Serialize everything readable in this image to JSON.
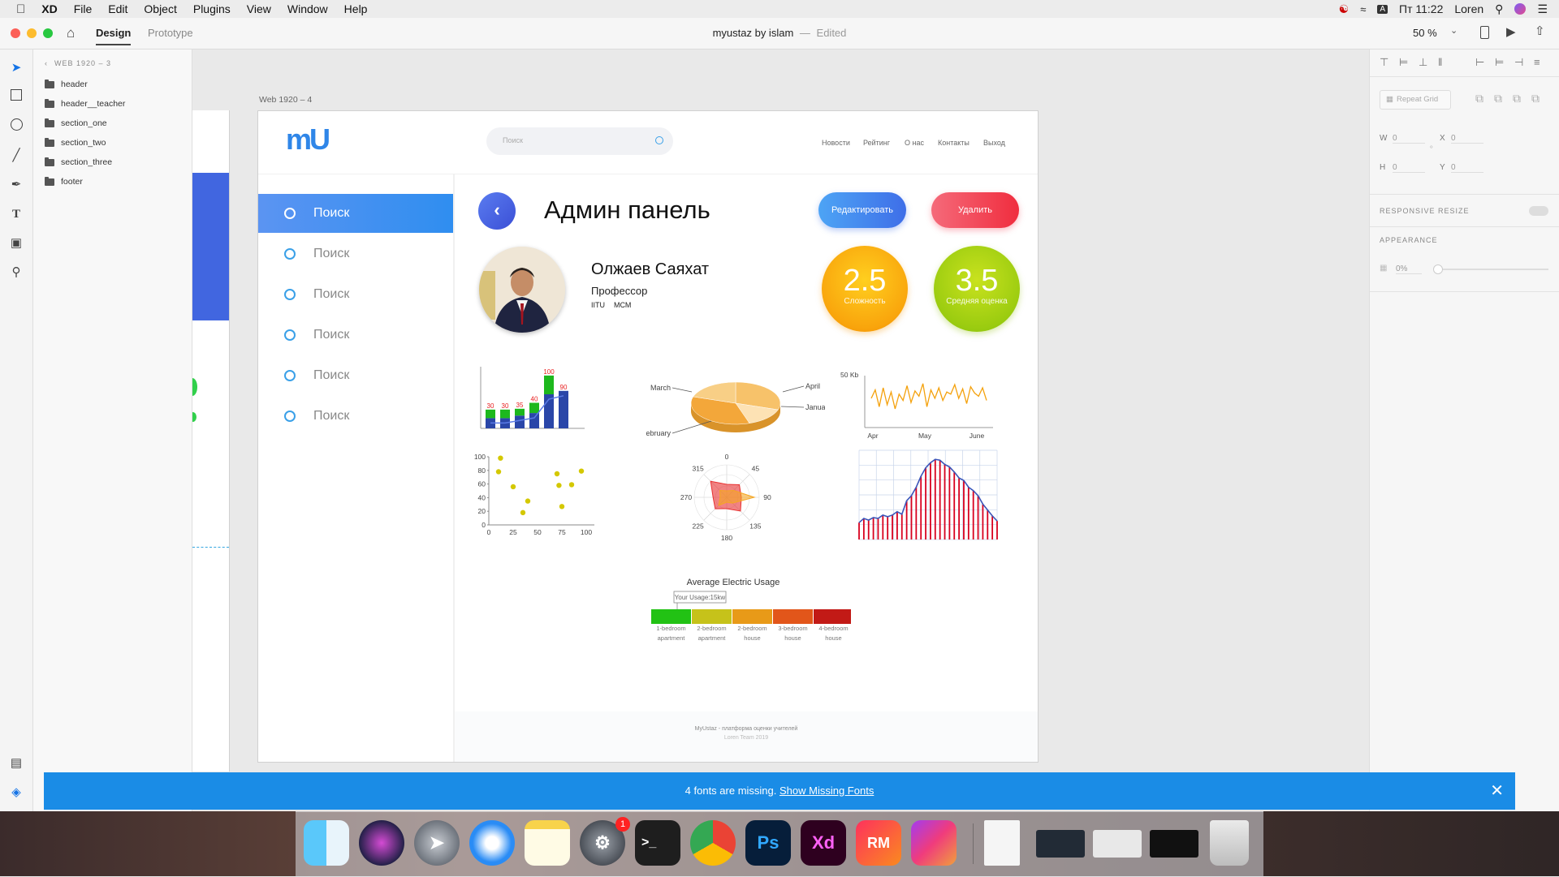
{
  "menubar": {
    "app": "XD",
    "items": [
      "File",
      "Edit",
      "Object",
      "Plugins",
      "View",
      "Window",
      "Help"
    ],
    "clock": "Пт 11:22",
    "user": "Loren",
    "input_source": "A"
  },
  "toolbar": {
    "tab_design": "Design",
    "tab_prototype": "Prototype",
    "doc_title": "myustaz by islam",
    "doc_status": "Edited",
    "separator": "—",
    "zoom": "50 %"
  },
  "layers": {
    "breadcrumb": "WEB 1920 – 3",
    "items": [
      "header",
      "header__teacher",
      "section_one",
      "section_two",
      "section_three",
      "footer"
    ]
  },
  "canvas": {
    "artboard_label": "Web 1920 – 4"
  },
  "props": {
    "repeat_grid": "Repeat Grid",
    "w_label": "W",
    "w_value": "0",
    "x_label": "X",
    "x_value": "0",
    "h_label": "H",
    "h_value": "0",
    "y_label": "Y",
    "y_value": "0",
    "responsive_resize": "RESPONSIVE RESIZE",
    "appearance": "APPEARANCE",
    "opacity": "0%"
  },
  "page": {
    "logo": "mU",
    "search_placeholder": "Поиск",
    "nav": [
      "Новости",
      "Рейтинг",
      "О нас",
      "Контакты",
      "Выход"
    ],
    "sidebar": [
      "Поиск",
      "Поиск",
      "Поиск",
      "Поиск",
      "Поиск",
      "Поиск"
    ],
    "title": "Админ панель",
    "edit_button": "Редактировать",
    "delete_button": "Удалить",
    "teacher_name": "Олжаев Саяхат",
    "teacher_role": "Профессор",
    "teacher_org1": "IITU",
    "teacher_org2": "МСМ",
    "stat1_value": "2.5",
    "stat1_label": "Сложность",
    "stat2_value": "3.5",
    "stat2_label": "Средняя оценка",
    "footer_line1": "MyUstaz - платформа оценки учителей",
    "footer_line2": "Loren Team 2019"
  },
  "chart_data": [
    {
      "type": "bar",
      "bar_labels": [
        "30",
        "30",
        "35",
        "40",
        "100",
        "90"
      ],
      "series": [
        {
          "values": [
            12,
            12,
            15,
            18,
            40,
            44
          ]
        },
        {
          "values": [
            10,
            10,
            8,
            12,
            22,
            0
          ]
        }
      ],
      "colors": {
        "bottom": "#2a46a8",
        "top": "#1db81d",
        "line": "#5b7be6",
        "labels": "#e82020"
      }
    },
    {
      "type": "pie",
      "labels": [
        "March",
        "April",
        "January",
        "February"
      ],
      "values": [
        30,
        15,
        35,
        20
      ],
      "colors": [
        "#f7c26a",
        "#fde2b4",
        "#f3a73a",
        "#f8cf86"
      ]
    },
    {
      "type": "line",
      "ylabel": "50 Kb",
      "x_ticks": [
        "Apr",
        "May",
        "June"
      ],
      "values": [
        20,
        28,
        12,
        30,
        14,
        26,
        10,
        24,
        18,
        32,
        16,
        27,
        22,
        34,
        12,
        28,
        20,
        30,
        18,
        26,
        24,
        33,
        20,
        29,
        15,
        31,
        25,
        22,
        30,
        18
      ],
      "color": "#f4a10c"
    },
    {
      "type": "scatter",
      "x_ticks": [
        "0",
        "25",
        "50",
        "75",
        "100"
      ],
      "y_ticks": [
        "0",
        "20",
        "40",
        "60",
        "80",
        "100"
      ],
      "points": [
        [
          12,
          98
        ],
        [
          10,
          78
        ],
        [
          25,
          56
        ],
        [
          35,
          18
        ],
        [
          40,
          35
        ],
        [
          70,
          75
        ],
        [
          72,
          58
        ],
        [
          75,
          27
        ],
        [
          85,
          59
        ],
        [
          95,
          79
        ]
      ],
      "color": "#d4c800"
    },
    {
      "type": "polar",
      "angle_ticks": [
        "0",
        "45",
        "90",
        "135",
        "180",
        "225",
        "270",
        "315"
      ],
      "series": [
        {
          "values": [
            40,
            55,
            45,
            60,
            35,
            50,
            42,
            70
          ],
          "color": "#e83030"
        },
        {
          "values": [
            20,
            30,
            85,
            25,
            15,
            35,
            20,
            30
          ],
          "color": "#f5a623"
        }
      ]
    },
    {
      "type": "area",
      "values": [
        20,
        25,
        23,
        26,
        25,
        29,
        27,
        29,
        33,
        30,
        46,
        52,
        62,
        75,
        85,
        91,
        95,
        94,
        89,
        86,
        80,
        73,
        70,
        62,
        58,
        52,
        42,
        35,
        28,
        22
      ],
      "color": "#d8001e",
      "line_color": "#3b55b9"
    },
    {
      "type": "gauge",
      "title": "Average Electric Usage",
      "marker_label": "Your Usage:15kw",
      "categories": [
        "1-bedroom apartment",
        "2-bedroom apartment",
        "2-bedroom house",
        "3-bedroom house",
        "4-bedroom house"
      ],
      "colors": [
        "#22c214",
        "#c6c21a",
        "#e89a18",
        "#e2561a",
        "#c21a16"
      ],
      "value": 15
    }
  ],
  "notification": {
    "text": "4 fonts are missing.",
    "link": "Show Missing Fonts"
  },
  "dock": {
    "apps": [
      "Finder",
      "Siri",
      "Launchpad",
      "Safari",
      "Notes",
      "System Preferences",
      "Terminal",
      "Chrome",
      "Ps",
      "Xd",
      "RM",
      "Final Cut"
    ],
    "badge": "1"
  }
}
